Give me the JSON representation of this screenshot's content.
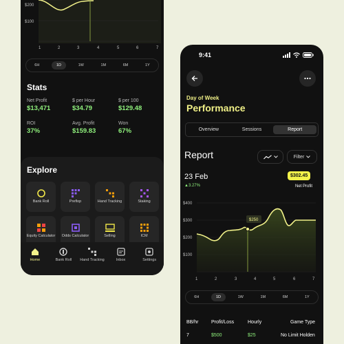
{
  "left_phone": {
    "chart": {
      "y_ticks": [
        "$200",
        "$100"
      ],
      "x_ticks": [
        "1",
        "2",
        "3",
        "4",
        "5",
        "6",
        "7"
      ]
    },
    "ranges": [
      "6H",
      "1D",
      "1W",
      "1M",
      "6M",
      "1Y"
    ],
    "active_range": "1D",
    "stats": {
      "title": "Stats",
      "items": [
        {
          "label": "Net Profit",
          "value": "$13,471"
        },
        {
          "label": "$ per Hour",
          "value": "$34.79"
        },
        {
          "label": "$ per 100",
          "value": "$129.48"
        },
        {
          "label": "ROI",
          "value": "37%"
        },
        {
          "label": "Avg. Profit",
          "value": "$159.83"
        },
        {
          "label": "Won",
          "value": "67%"
        }
      ]
    },
    "explore": {
      "title": "Explore",
      "tiles": [
        {
          "label": "Bank Roll",
          "icon": "bankroll-icon"
        },
        {
          "label": "Preflop",
          "icon": "preflop-icon"
        },
        {
          "label": "Hand Tracking",
          "icon": "hand-tracking-icon"
        },
        {
          "label": "Staking",
          "icon": "staking-icon"
        },
        {
          "label": "Equity Calculator",
          "icon": "equity-calculator-icon"
        },
        {
          "label": "Odds Calculator",
          "icon": "odds-calculator-icon"
        },
        {
          "label": "Selling",
          "icon": "selling-icon"
        },
        {
          "label": "ICM",
          "icon": "icm-icon"
        }
      ]
    },
    "nav": [
      {
        "label": "Home",
        "icon": "home-icon"
      },
      {
        "label": "Bank Roll",
        "icon": "bankroll-icon"
      },
      {
        "label": "Hand Tracking",
        "icon": "hand-tracking-icon"
      },
      {
        "label": "Inbox",
        "icon": "inbox-icon"
      },
      {
        "label": "Settings",
        "icon": "settings-icon"
      }
    ]
  },
  "right_phone": {
    "time": "9:41",
    "subtitle": "Day of Week",
    "title": "Performance",
    "tabs": [
      "Overview",
      "Sessions",
      "Report"
    ],
    "active_tab": "Report",
    "report_title": "Report",
    "filter_label": "Filter",
    "date": "23 Feb",
    "change": "▲3.27%",
    "net_value": "$302.45",
    "net_label": "Net Profit",
    "tooltip": "$250",
    "y_ticks": [
      "$400",
      "$300",
      "$200",
      "$100"
    ],
    "x_ticks": [
      "1",
      "2",
      "3",
      "4",
      "5",
      "6",
      "7"
    ],
    "ranges": [
      "6H",
      "1D",
      "1W",
      "1M",
      "6M",
      "1Y"
    ],
    "active_range": "1D",
    "table": {
      "headers": [
        "BB/hr",
        "Profit/Loss",
        "Hourly",
        "Game Type"
      ],
      "row": [
        "7",
        "$500",
        "$25",
        "No Limit Holden"
      ]
    }
  },
  "colors": {
    "background": "#eef0df",
    "accent": "#f2f28a",
    "positive": "#8ff07c"
  }
}
